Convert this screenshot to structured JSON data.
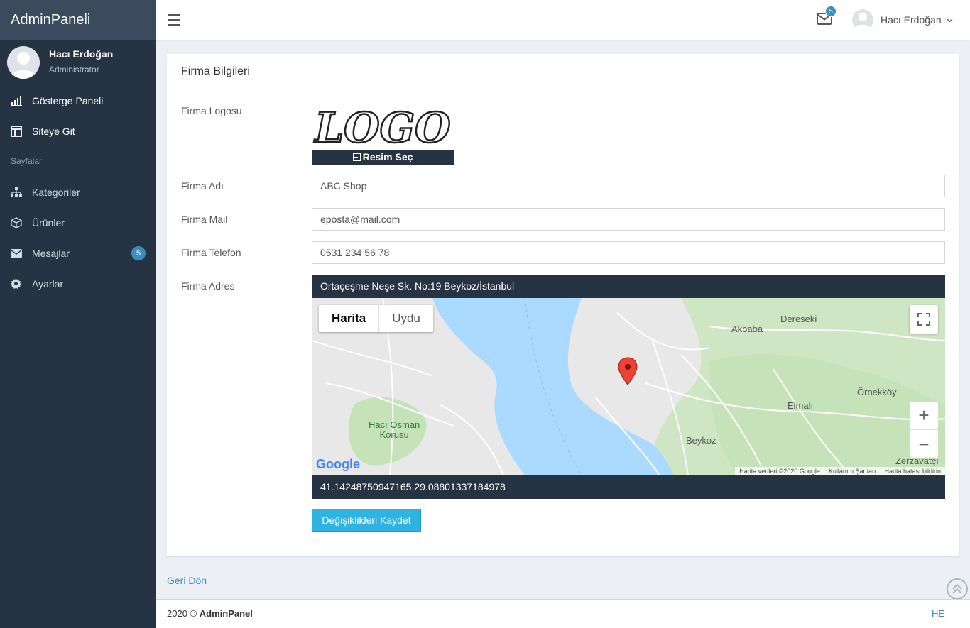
{
  "brand": "AdminPaneli",
  "user": {
    "name": "Hacı Erdoğan",
    "role": "Administrator"
  },
  "sidebar": {
    "items": [
      {
        "label": "Gösterge Paneli",
        "icon": "bar-chart-icon"
      },
      {
        "label": "Siteye Git",
        "icon": "layout-icon"
      }
    ],
    "section_header": "Sayfalar",
    "pages": [
      {
        "label": "Kategoriler",
        "icon": "sitemap-icon"
      },
      {
        "label": "Ürünler",
        "icon": "cube-icon"
      },
      {
        "label": "Mesajlar",
        "icon": "envelope-icon",
        "badge": "5"
      },
      {
        "label": "Ayarlar",
        "icon": "gear-icon"
      }
    ]
  },
  "topbar": {
    "mail_badge": "5",
    "user_name": "Hacı Erdoğan"
  },
  "form": {
    "title": "Firma Bilgileri",
    "logo_label": "Firma Logosu",
    "logo_text": "LOGO",
    "logo_button": "Resim Seç",
    "name_label": "Firma Adı",
    "name_value": "ABC Shop",
    "mail_label": "Firma Mail",
    "mail_value": "eposta@mail.com",
    "phone_label": "Firma Telefon",
    "phone_value": "0531 234 56 78",
    "address_label": "Firma Adres",
    "address_value": "Ortaçeşme Neşe Sk. No:19 Beykoz/İstanbul",
    "coordinates": "41.14248750947165,29.08801337184978",
    "save_button": "Değişiklikleri Kaydet"
  },
  "map": {
    "type_map": "Harita",
    "type_satellite": "Uydu",
    "zoom_in": "+",
    "zoom_out": "−",
    "places": {
      "akbaba": "Akbaba",
      "dereseki": "Dereseki",
      "ornekkoy": "Örnekköy",
      "elmali": "Elmalı",
      "beykoz": "Beykoz",
      "zerzavatci": "Zerzavatçı",
      "haci_osman_1": "Hacı Osman",
      "haci_osman_2": "Korusu"
    },
    "google": "Google",
    "attribution": "Harita verileri ©2020 Google",
    "terms": "Kullanım Şartları",
    "report": "Harita hatası bildirin"
  },
  "back_link": "Geri Dön",
  "footer": {
    "year": "2020 ©",
    "brand": "AdminPanel",
    "right": "HE"
  },
  "colors": {
    "sidebar": "#263343",
    "brand_bg": "#3b4a5c",
    "accent": "#3c8dbc",
    "save": "#2fb3e0"
  }
}
